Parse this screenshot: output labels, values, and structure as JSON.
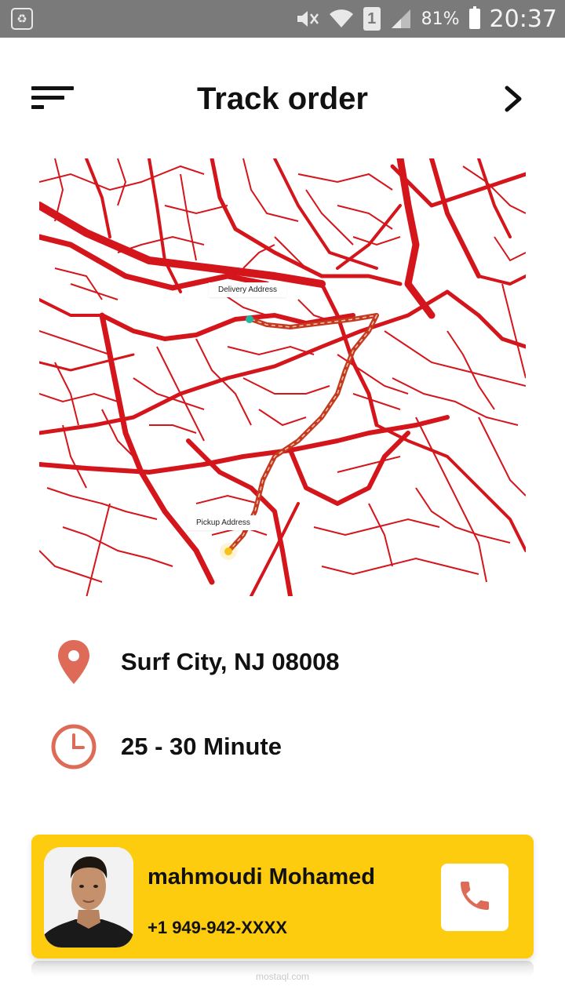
{
  "status_bar": {
    "battery_percent": "81%",
    "time": "20:37",
    "sim_slot": "1",
    "icons": [
      "recycle-icon",
      "mute-icon",
      "wifi-icon",
      "sim-icon",
      "signal-icon",
      "battery-icon"
    ]
  },
  "header": {
    "title": "Track order",
    "menu_icon": "menu-icon",
    "next_icon": "chevron-right-icon"
  },
  "map": {
    "delivery_label": "Delivery Address",
    "pickup_label": "Pickup Address",
    "road_color": "#d4161c",
    "route_color": "#c43a1f",
    "delivery_pin_color": "#22b8a0",
    "pickup_pin_color": "#f6c21a"
  },
  "info": {
    "address": "Surf City, NJ 08008",
    "eta": "25 - 30 Minute",
    "location_icon": "location-pin-icon",
    "clock_icon": "clock-icon",
    "icon_color": "#de6b57"
  },
  "driver": {
    "name": "mahmoudi Mohamed",
    "phone": "+1 949-942-XXXX",
    "call_icon": "phone-icon",
    "card_color": "#fdcc0f"
  },
  "watermark": "mostaql.com"
}
